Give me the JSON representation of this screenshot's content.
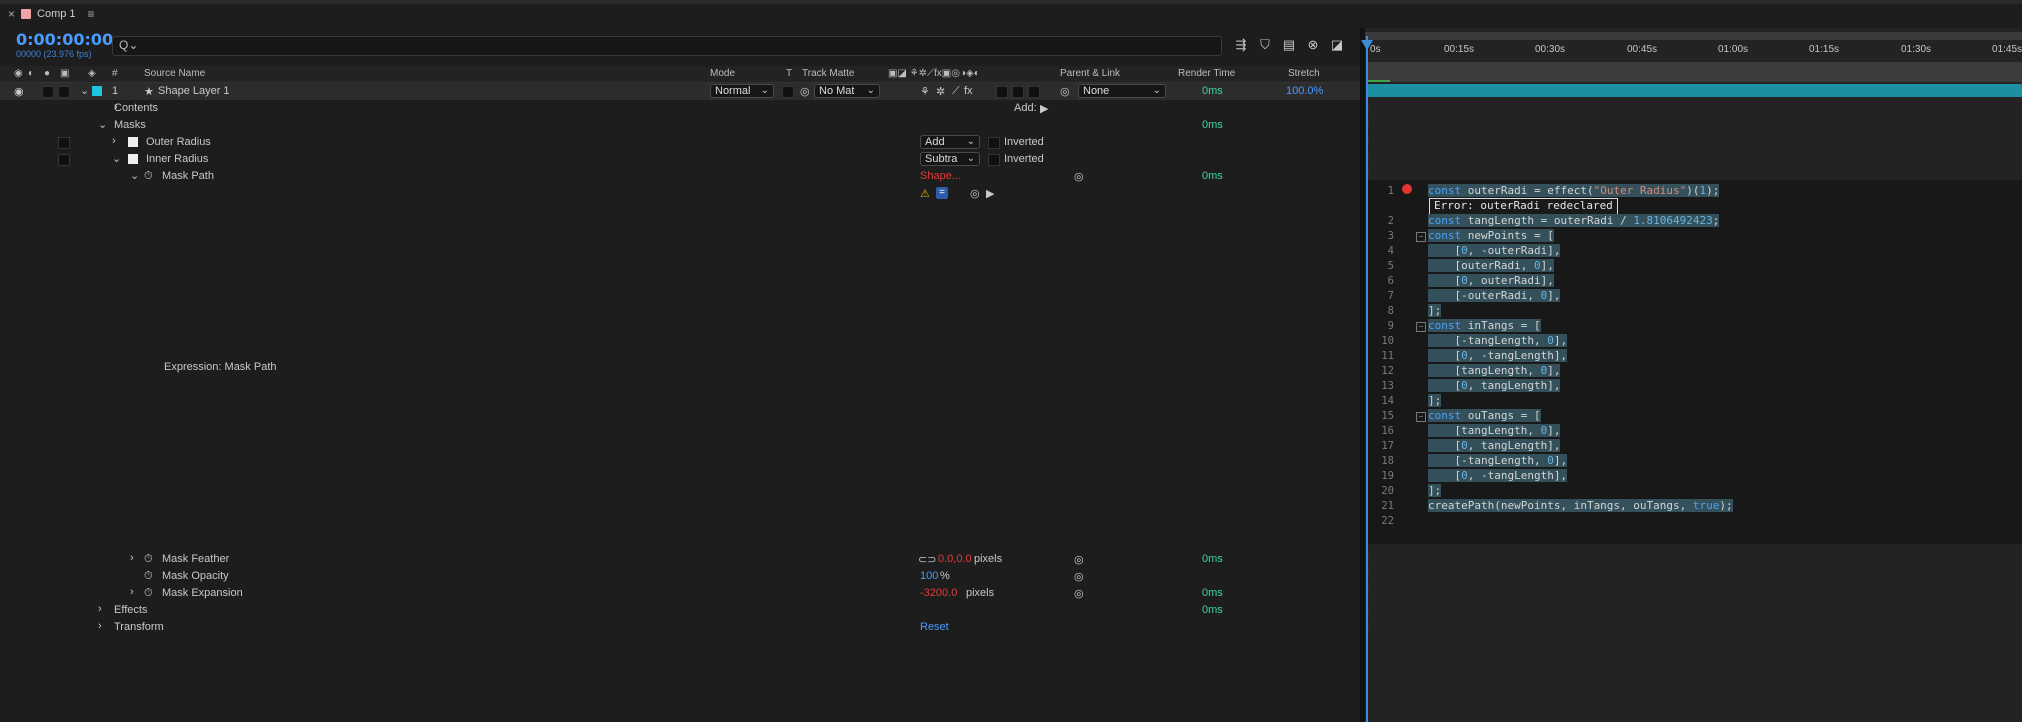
{
  "tab": {
    "close": "×",
    "title": "Comp 1",
    "menu": "≡"
  },
  "time": {
    "timecode": "0:00:00:00",
    "frames": "00000 (23.976 fps)"
  },
  "search": {
    "icon": "search-icon",
    "placeholder": "Q⌄"
  },
  "headers": {
    "num": "#",
    "source": "Source Name",
    "mode": "Mode",
    "t": "T",
    "trackmatte": "Track Matte",
    "parent": "Parent & Link",
    "render": "Render Time",
    "stretch": "Stretch"
  },
  "layer": {
    "index": "1",
    "name": "Shape Layer 1",
    "mode": "Normal",
    "matte": "No Mat",
    "parent": "None",
    "render": "0ms",
    "stretch": "100.0%"
  },
  "rows": {
    "contents": "Contents",
    "add_label": "Add:",
    "masks": "Masks",
    "masks_time": "0ms",
    "outer": "Outer Radius",
    "outer_mode": "Add",
    "outer_inverted": "Inverted",
    "inner": "Inner Radius",
    "inner_mode": "Subtra",
    "inner_inverted": "Inverted",
    "maskpath": "Mask Path",
    "maskpath_value": "Shape...",
    "maskpath_time": "0ms",
    "expr_label": "Expression: Mask Path",
    "feather": "Mask Feather",
    "feather_value": "0.0,0.0",
    "feather_unit": "pixels",
    "feather_time": "0ms",
    "opacity": "Mask Opacity",
    "opacity_value": "100",
    "opacity_unit": "%",
    "expansion": "Mask Expansion",
    "expansion_value": "-3200.0",
    "expansion_unit": "pixels",
    "expansion_time": "0ms",
    "effects": "Effects",
    "effects_time": "0ms",
    "transform": "Transform",
    "transform_reset": "Reset"
  },
  "ruler": [
    "0s",
    "00:15s",
    "00:30s",
    "00:45s",
    "01:00s",
    "01:15s",
    "01:30s",
    "01:45s"
  ],
  "code": {
    "error": "Error:  outerRadi redeclared",
    "line_numbers": [
      "1",
      "2",
      "3",
      "4",
      "5",
      "6",
      "7",
      "8",
      "9",
      "10",
      "11",
      "12",
      "13",
      "14",
      "15",
      "16",
      "17",
      "18",
      "19",
      "20",
      "21",
      "22"
    ]
  },
  "colors": {
    "accent": "#4a9bff",
    "layer_bar": "#1c8fa0",
    "error": "#e2352f",
    "time_green": "#3fd4a5"
  }
}
